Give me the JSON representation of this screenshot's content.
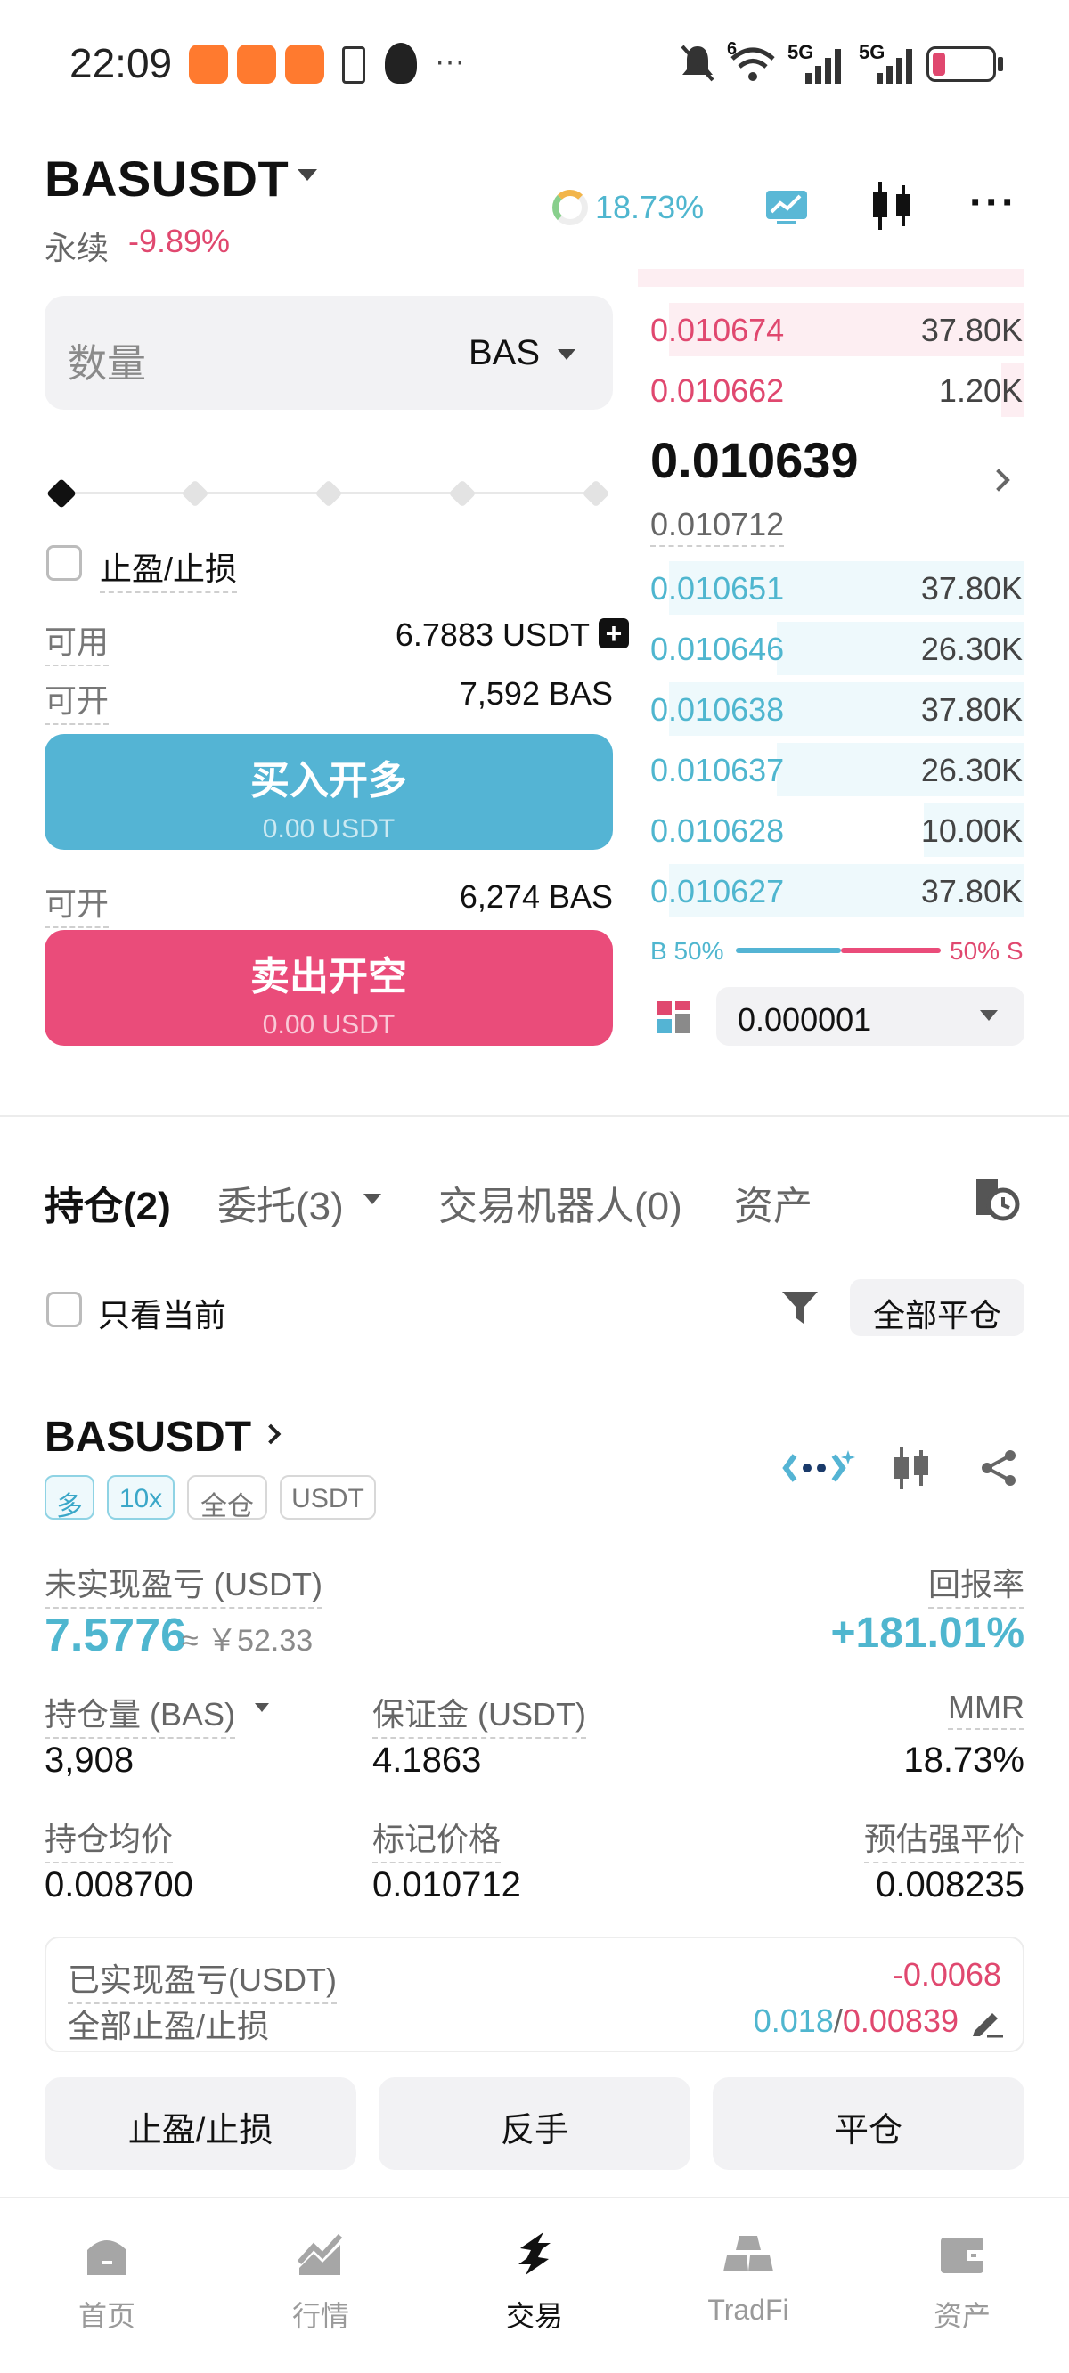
{
  "status_bar": {
    "time": "22:09",
    "network": "5G",
    "network2": "5G",
    "wifi_badge": "6"
  },
  "header": {
    "symbol": "BASUSDT",
    "type": "永续",
    "change": "-9.89%",
    "mmr": "18.73%"
  },
  "order": {
    "qty_label": "数量",
    "qty_unit": "BAS",
    "slider_percent": 0,
    "tpsl_label": "止盈/止损",
    "available_label": "可用",
    "available_value": "6.7883 USDT",
    "open_label": "可开",
    "open_long_value": "7,592 BAS",
    "buy_label": "买入开多",
    "buy_sub": "0.00 USDT",
    "open_short_value": "6,274 BAS",
    "sell_label": "卖出开空",
    "sell_sub": "0.00 USDT"
  },
  "orderbook": {
    "asks": [
      {
        "price": "0.010674",
        "qty": "37.80K",
        "depth": 0.92
      },
      {
        "price": "0.010662",
        "qty": "1.20K",
        "depth": 0.06
      }
    ],
    "last_price": "0.010639",
    "mark_price": "0.010712",
    "bids": [
      {
        "price": "0.010651",
        "qty": "37.80K",
        "depth": 0.92
      },
      {
        "price": "0.010646",
        "qty": "26.30K",
        "depth": 0.64
      },
      {
        "price": "0.010638",
        "qty": "37.80K",
        "depth": 0.92
      },
      {
        "price": "0.010637",
        "qty": "26.30K",
        "depth": 0.64
      },
      {
        "price": "0.010628",
        "qty": "10.00K",
        "depth": 0.26
      },
      {
        "price": "0.010627",
        "qty": "37.80K",
        "depth": 0.92
      }
    ],
    "buy_ratio": "B 50%",
    "sell_ratio": "50% S",
    "precision": "0.000001"
  },
  "tabs": [
    {
      "label": "持仓(2)"
    },
    {
      "label": "委托(3)"
    },
    {
      "label": "交易机器人(0)"
    },
    {
      "label": "资产"
    }
  ],
  "filter": {
    "only_current": "只看当前",
    "close_all": "全部平仓"
  },
  "position": {
    "symbol": "BASUSDT",
    "tags": [
      "多",
      "10x",
      "全仓",
      "USDT"
    ],
    "upnl_label": "未实现盈亏 (USDT)",
    "upnl_value": "7.5776",
    "upnl_cny": "≈ ￥52.33",
    "roe_label": "回报率",
    "roe_value": "+181.01%",
    "size_label": "持仓量 (BAS)",
    "size_value": "3,908",
    "margin_label": "保证金 (USDT)",
    "margin_value": "4.1863",
    "mmr_label": "MMR",
    "mmr_value": "18.73%",
    "entry_label": "持仓均价",
    "entry_value": "0.008700",
    "markp_label": "标记价格",
    "markp_value": "0.010712",
    "liq_label": "预估强平价",
    "liq_value": "0.008235",
    "realized_label": "已实现盈亏(USDT)",
    "realized_value": "-0.0068",
    "tpsl_all_label": "全部止盈/止损",
    "tp_value": "0.018",
    "sl_sep": "/",
    "sl_value": "0.00839",
    "btn_tpsl": "止盈/止损",
    "btn_reverse": "反手",
    "btn_close": "平仓"
  },
  "nav": [
    {
      "label": "首页"
    },
    {
      "label": "行情"
    },
    {
      "label": "交易"
    },
    {
      "label": "TradFi"
    },
    {
      "label": "资产"
    }
  ],
  "colors": {
    "up": "#54b4d4",
    "down": "#ea4c7a",
    "warn": "#e8a94a"
  }
}
